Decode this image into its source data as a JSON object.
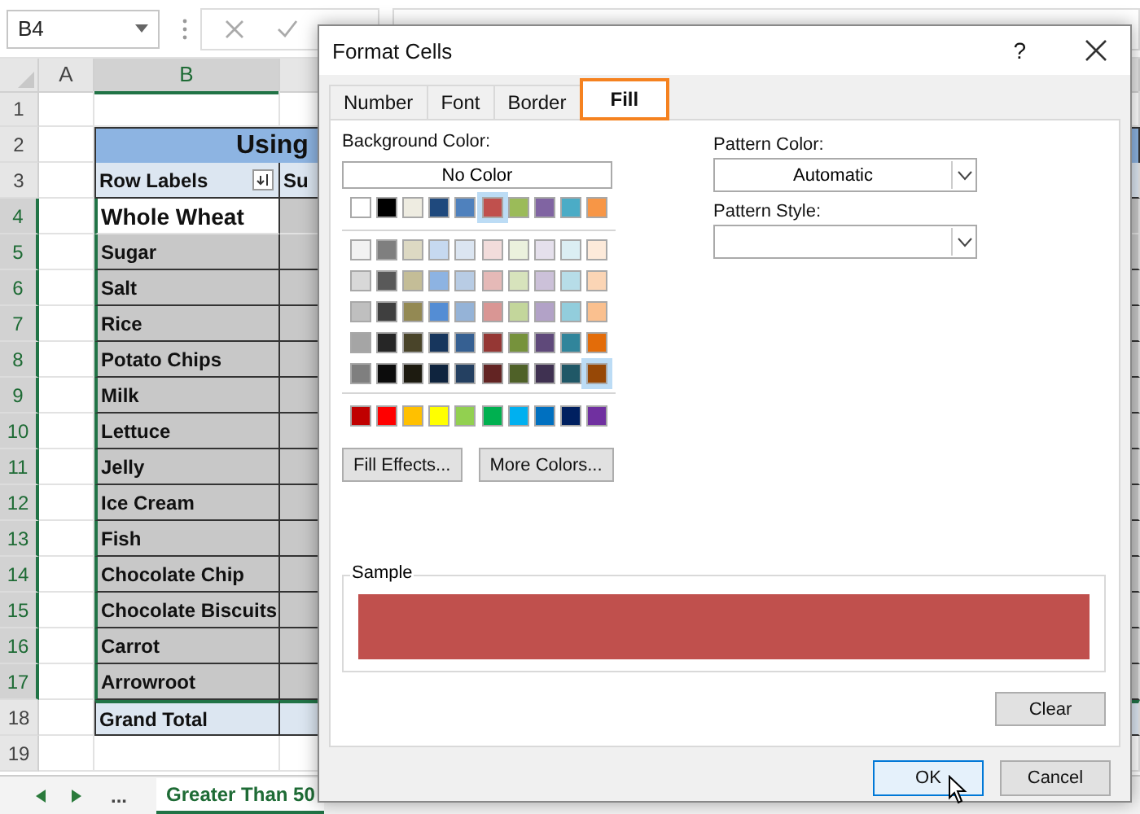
{
  "name_box": {
    "value": "B4"
  },
  "columns": [
    {
      "label": "A",
      "selected": false
    },
    {
      "label": "B",
      "selected": true
    }
  ],
  "rows": [
    {
      "number": "1",
      "selected": false,
      "kind": "empty"
    },
    {
      "number": "2",
      "selected": false,
      "kind": "title",
      "b": "Using"
    },
    {
      "number": "3",
      "selected": false,
      "kind": "header",
      "b": "Row Labels",
      "c": "Su"
    },
    {
      "number": "4",
      "selected": true,
      "kind": "active",
      "b": "Whole Wheat"
    },
    {
      "number": "5",
      "selected": true,
      "kind": "item",
      "b": "Sugar"
    },
    {
      "number": "6",
      "selected": true,
      "kind": "item",
      "b": "Salt"
    },
    {
      "number": "7",
      "selected": true,
      "kind": "item",
      "b": "Rice"
    },
    {
      "number": "8",
      "selected": true,
      "kind": "item",
      "b": "Potato Chips"
    },
    {
      "number": "9",
      "selected": true,
      "kind": "item",
      "b": "Milk"
    },
    {
      "number": "10",
      "selected": true,
      "kind": "item",
      "b": "Lettuce"
    },
    {
      "number": "11",
      "selected": true,
      "kind": "item",
      "b": "Jelly"
    },
    {
      "number": "12",
      "selected": true,
      "kind": "item",
      "b": "Ice Cream"
    },
    {
      "number": "13",
      "selected": true,
      "kind": "item",
      "b": "Fish"
    },
    {
      "number": "14",
      "selected": true,
      "kind": "item",
      "b": "Chocolate Chip"
    },
    {
      "number": "15",
      "selected": true,
      "kind": "item",
      "b": "Chocolate Biscuits"
    },
    {
      "number": "16",
      "selected": true,
      "kind": "item",
      "b": "Carrot"
    },
    {
      "number": "17",
      "selected": true,
      "kind": "item",
      "b": "Arrowroot"
    },
    {
      "number": "18",
      "selected": false,
      "kind": "total",
      "b": "Grand Total"
    },
    {
      "number": "19",
      "selected": false,
      "kind": "empty"
    }
  ],
  "sheet_tabs": {
    "more": "...",
    "tabs": [
      {
        "label": "Greater Than 50",
        "selected": true
      }
    ]
  },
  "dialog": {
    "title": "Format Cells",
    "help": "?",
    "tabs": [
      {
        "label": "Number",
        "selected": false
      },
      {
        "label": "Font",
        "selected": false
      },
      {
        "label": "Border",
        "selected": false
      },
      {
        "label": "Fill",
        "selected": true
      }
    ],
    "background_color": {
      "label": "Background Color:",
      "no_color": "No Color",
      "theme_colors": [
        {
          "color": "#ffffff",
          "selected": false
        },
        {
          "color": "#000000",
          "selected": false
        },
        {
          "color": "#eeece1",
          "selected": false
        },
        {
          "color": "#1f497d",
          "selected": false
        },
        {
          "color": "#4f81bd",
          "selected": false
        },
        {
          "color": "#c0504d",
          "selected": true
        },
        {
          "color": "#9bbb59",
          "selected": false
        },
        {
          "color": "#8064a2",
          "selected": false
        },
        {
          "color": "#4bacc6",
          "selected": false
        },
        {
          "color": "#f79646",
          "selected": false
        }
      ],
      "shades": [
        [
          {
            "color": "#f2f2f2",
            "selected": false
          },
          {
            "color": "#7f7f7f",
            "selected": false
          },
          {
            "color": "#ddd9c3",
            "selected": false
          },
          {
            "color": "#c6d9f0",
            "selected": false
          },
          {
            "color": "#dbe5f1",
            "selected": false
          },
          {
            "color": "#f2dcdb",
            "selected": false
          },
          {
            "color": "#ebf1dd",
            "selected": false
          },
          {
            "color": "#e5e0ec",
            "selected": false
          },
          {
            "color": "#dbeef3",
            "selected": false
          },
          {
            "color": "#fdeada",
            "selected": false
          }
        ],
        [
          {
            "color": "#d8d8d8",
            "selected": false
          },
          {
            "color": "#595959",
            "selected": false
          },
          {
            "color": "#c4bd97",
            "selected": false
          },
          {
            "color": "#8db3e2",
            "selected": false
          },
          {
            "color": "#b8cce4",
            "selected": false
          },
          {
            "color": "#e5b9b7",
            "selected": false
          },
          {
            "color": "#d7e3bc",
            "selected": false
          },
          {
            "color": "#ccc1d9",
            "selected": false
          },
          {
            "color": "#b7dde8",
            "selected": false
          },
          {
            "color": "#fbd5b5",
            "selected": false
          }
        ],
        [
          {
            "color": "#bfbfbf",
            "selected": false
          },
          {
            "color": "#3f3f3f",
            "selected": false
          },
          {
            "color": "#938953",
            "selected": false
          },
          {
            "color": "#548dd4",
            "selected": false
          },
          {
            "color": "#95b3d7",
            "selected": false
          },
          {
            "color": "#d99694",
            "selected": false
          },
          {
            "color": "#c3d69b",
            "selected": false
          },
          {
            "color": "#b2a2c7",
            "selected": false
          },
          {
            "color": "#92cddc",
            "selected": false
          },
          {
            "color": "#fac08f",
            "selected": false
          }
        ],
        [
          {
            "color": "#a5a5a5",
            "selected": false
          },
          {
            "color": "#262626",
            "selected": false
          },
          {
            "color": "#494429",
            "selected": false
          },
          {
            "color": "#17365d",
            "selected": false
          },
          {
            "color": "#366092",
            "selected": false
          },
          {
            "color": "#953734",
            "selected": false
          },
          {
            "color": "#76923c",
            "selected": false
          },
          {
            "color": "#5f497a",
            "selected": false
          },
          {
            "color": "#31859b",
            "selected": false
          },
          {
            "color": "#e36c09",
            "selected": false
          }
        ],
        [
          {
            "color": "#7f7f7f",
            "selected": false
          },
          {
            "color": "#0c0c0c",
            "selected": false
          },
          {
            "color": "#1d1b10",
            "selected": false
          },
          {
            "color": "#0f243e",
            "selected": false
          },
          {
            "color": "#244061",
            "selected": false
          },
          {
            "color": "#632423",
            "selected": false
          },
          {
            "color": "#4f6128",
            "selected": false
          },
          {
            "color": "#3f3151",
            "selected": false
          },
          {
            "color": "#205867",
            "selected": false
          },
          {
            "color": "#974806",
            "selected": true
          }
        ]
      ],
      "standard_colors": [
        {
          "color": "#c00000",
          "selected": false
        },
        {
          "color": "#ff0000",
          "selected": false
        },
        {
          "color": "#ffc000",
          "selected": false
        },
        {
          "color": "#ffff00",
          "selected": false
        },
        {
          "color": "#92d050",
          "selected": false
        },
        {
          "color": "#00b050",
          "selected": false
        },
        {
          "color": "#00b0f0",
          "selected": false
        },
        {
          "color": "#0070c0",
          "selected": false
        },
        {
          "color": "#002060",
          "selected": false
        },
        {
          "color": "#7030a0",
          "selected": false
        }
      ],
      "fill_effects": "Fill Effects...",
      "more_colors": "More Colors..."
    },
    "pattern_color": {
      "label": "Pattern Color:",
      "value": "Automatic"
    },
    "pattern_style": {
      "label": "Pattern Style:"
    },
    "sample": {
      "label": "Sample",
      "color": "#c0504d"
    },
    "clear": "Clear",
    "ok": "OK",
    "cancel": "Cancel"
  }
}
